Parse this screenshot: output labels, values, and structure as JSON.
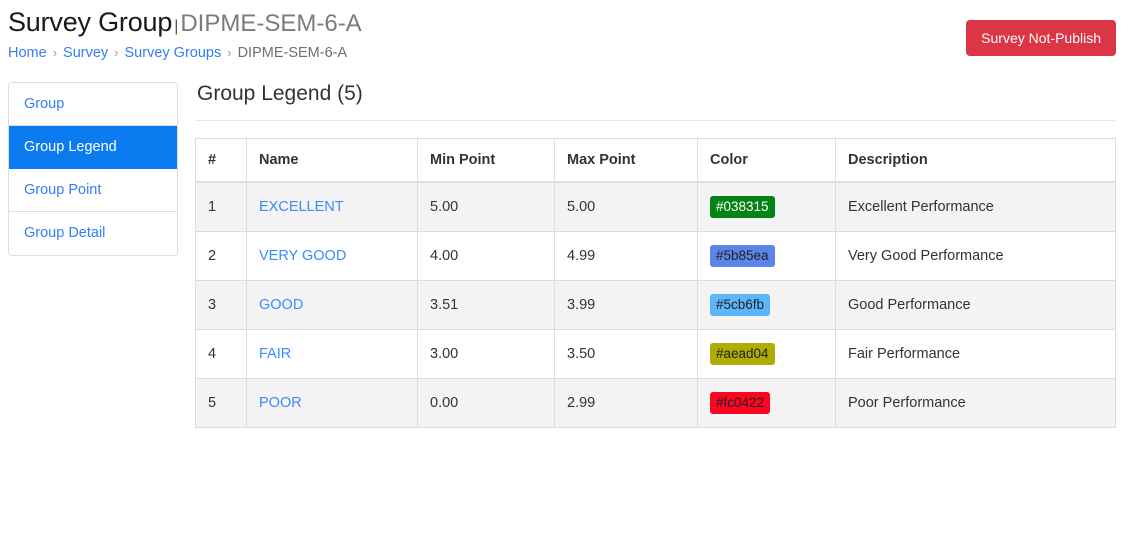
{
  "header": {
    "title_main": "Survey Group",
    "title_separator": "|",
    "title_sub": "DIPME-SEM-6-A",
    "publish_button": "Survey Not-Publish",
    "publish_button_color": "#dc3545"
  },
  "breadcrumb": {
    "separator": "›",
    "items": [
      {
        "label": "Home",
        "link": true
      },
      {
        "label": "Survey",
        "link": true
      },
      {
        "label": "Survey Groups",
        "link": true
      },
      {
        "label": "DIPME-SEM-6-A",
        "link": false
      }
    ]
  },
  "sidebar": {
    "active_color": "#0b7bf0",
    "items": [
      {
        "label": "Group",
        "active": false
      },
      {
        "label": "Group Legend",
        "active": true
      },
      {
        "label": "Group Point",
        "active": false
      },
      {
        "label": "Group Detail",
        "active": false
      }
    ]
  },
  "main": {
    "panel_title": "Group Legend (5)",
    "table": {
      "columns": [
        "#",
        "Name",
        "Min Point",
        "Max Point",
        "Color",
        "Description"
      ],
      "rows": [
        {
          "num": "1",
          "name": "EXCELLENT",
          "min_point": "5.00",
          "max_point": "5.00",
          "color": "#038315",
          "color_text": "#ffffff",
          "description": "Excellent Performance"
        },
        {
          "num": "2",
          "name": "VERY GOOD",
          "min_point": "4.00",
          "max_point": "4.99",
          "color": "#5b85ea",
          "color_text": "#222222",
          "description": "Very Good Performance"
        },
        {
          "num": "3",
          "name": "GOOD",
          "min_point": "3.51",
          "max_point": "3.99",
          "color": "#5cb6fb",
          "color_text": "#222222",
          "description": "Good Performance"
        },
        {
          "num": "4",
          "name": "FAIR",
          "min_point": "3.00",
          "max_point": "3.50",
          "color": "#aead04",
          "color_text": "#222222",
          "description": "Fair Performance"
        },
        {
          "num": "5",
          "name": "POOR",
          "min_point": "0.00",
          "max_point": "2.99",
          "color": "#fc0422",
          "color_text": "#222222",
          "description": "Poor Performance"
        }
      ]
    }
  }
}
